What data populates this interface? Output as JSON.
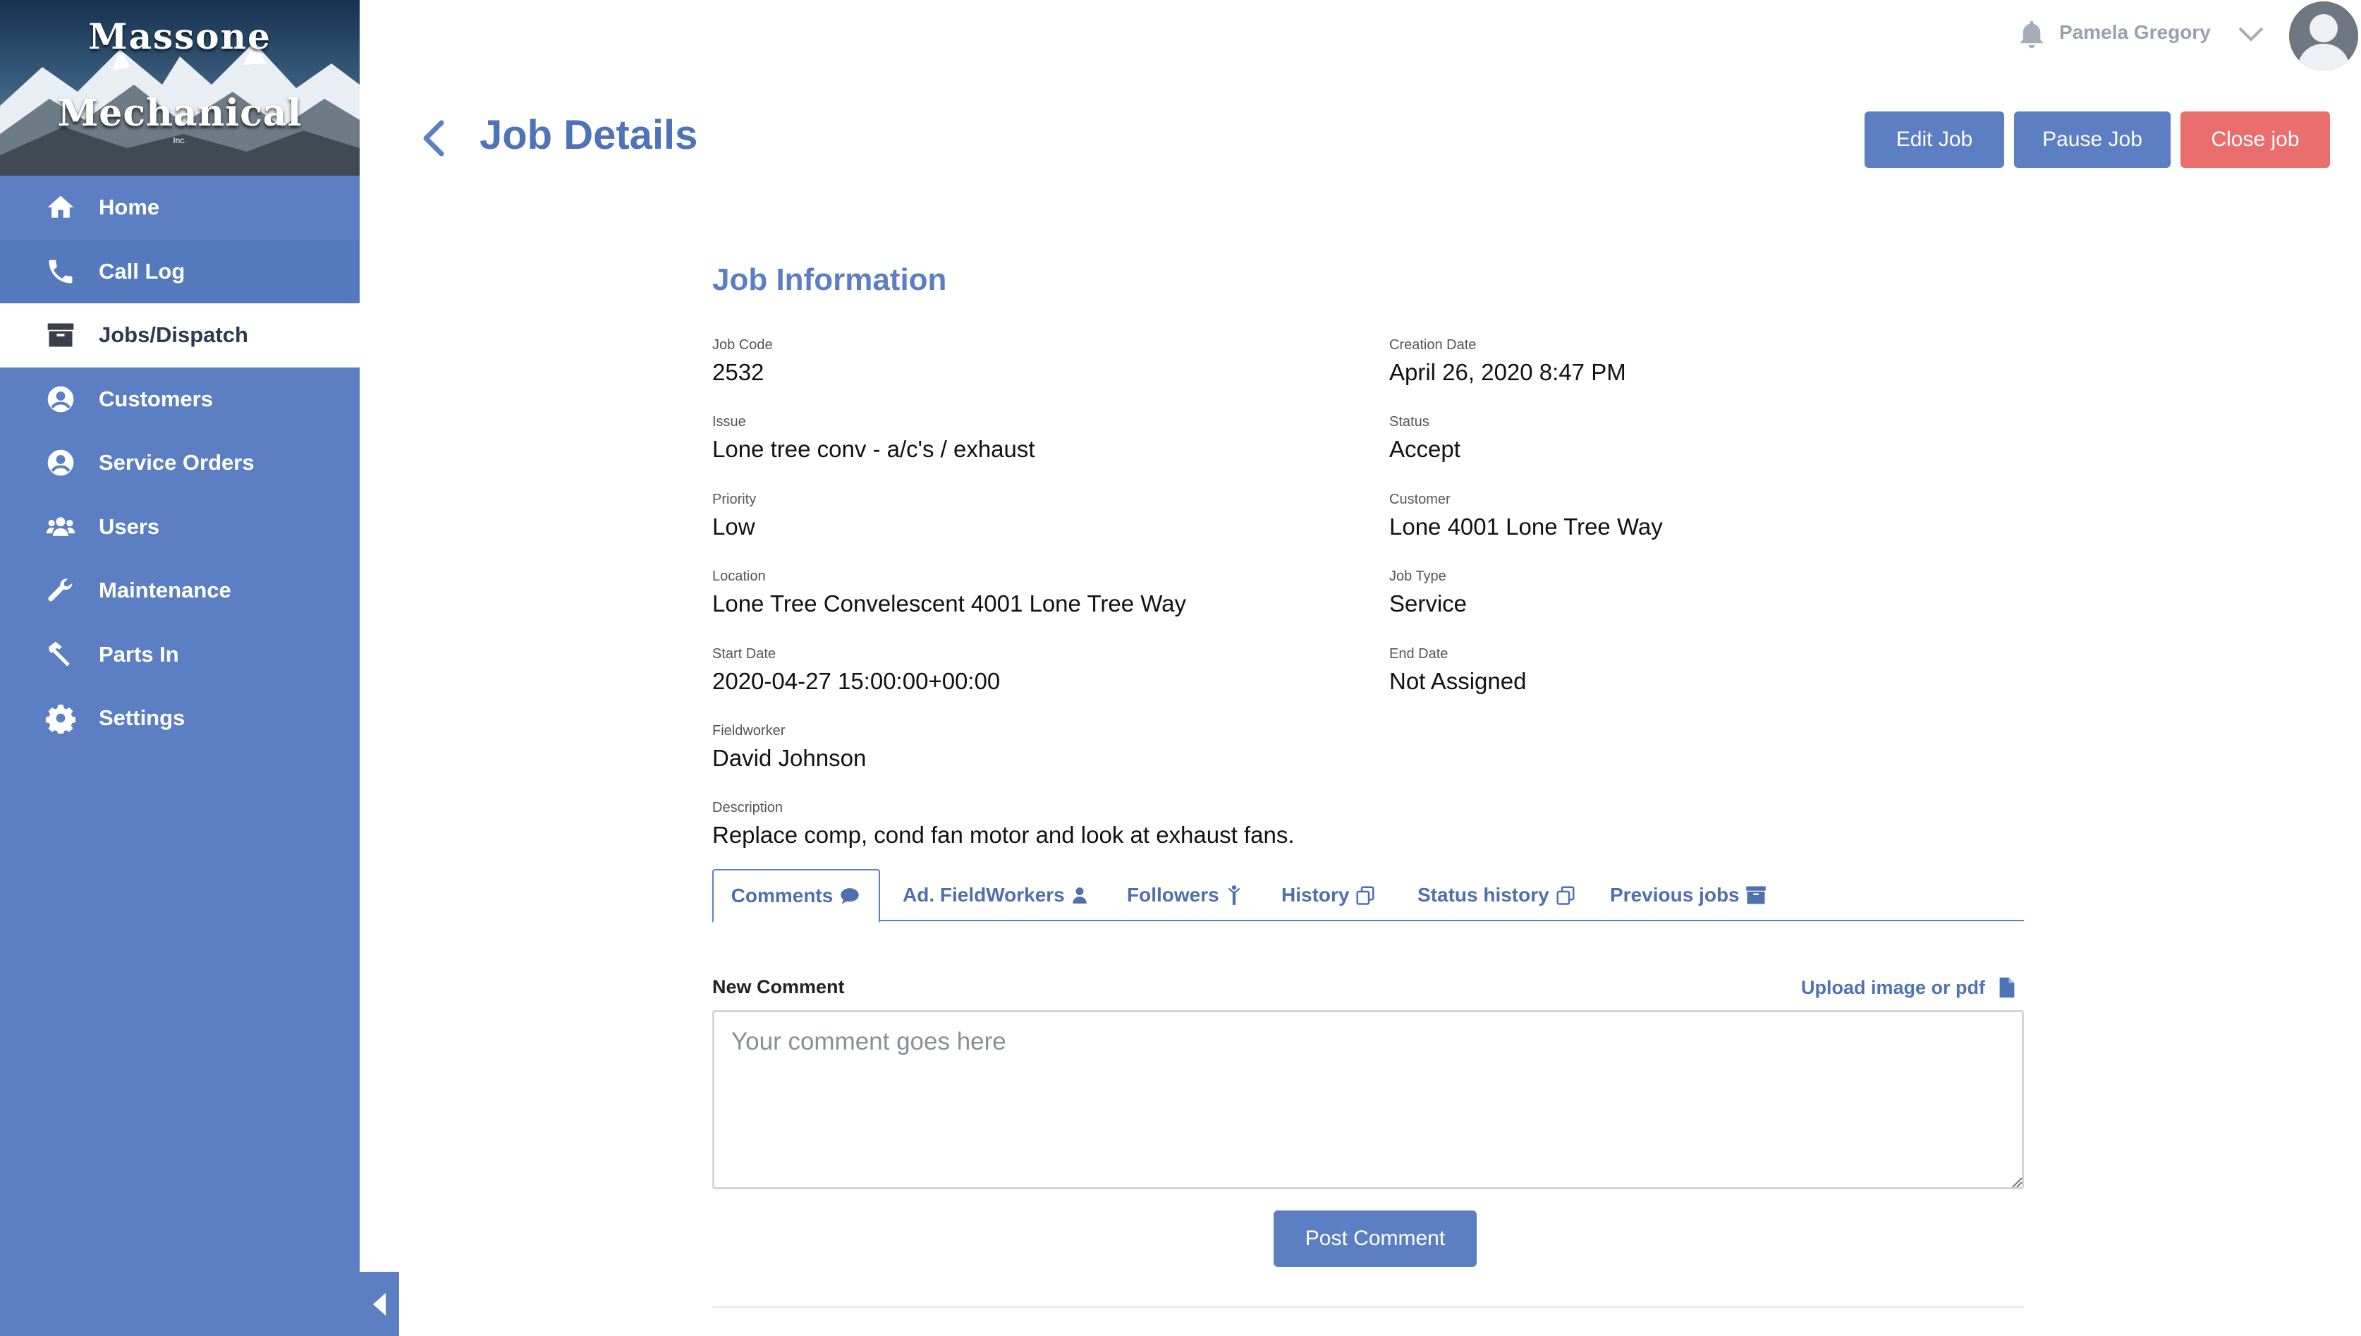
{
  "logo": {
    "line1": "Massone",
    "line2": "Mechanical",
    "line3": "Inc."
  },
  "nav": {
    "items": [
      {
        "label": "Home",
        "icon": "home-icon"
      },
      {
        "label": "Call Log",
        "icon": "phone-icon"
      },
      {
        "label": "Jobs/Dispatch",
        "icon": "archive-icon",
        "active": true
      },
      {
        "label": "Customers",
        "icon": "user-circle-icon"
      },
      {
        "label": "Service Orders",
        "icon": "user-circle-icon"
      },
      {
        "label": "Users",
        "icon": "users-icon"
      },
      {
        "label": "Maintenance",
        "icon": "wrench-icon"
      },
      {
        "label": "Parts In",
        "icon": "hammer-icon"
      },
      {
        "label": "Settings",
        "icon": "gear-icon"
      }
    ]
  },
  "user": {
    "name": "Pamela Gregory"
  },
  "header": {
    "title": "Job Details"
  },
  "actions": {
    "edit": "Edit Job",
    "pause": "Pause Job",
    "close": "Close job"
  },
  "job": {
    "section_title": "Job Information",
    "job_code": {
      "label": "Job Code",
      "value": "2532"
    },
    "creation_date": {
      "label": "Creation Date",
      "value": "April 26, 2020 8:47 PM"
    },
    "issue": {
      "label": "Issue",
      "value": "Lone tree conv - a/c's / exhaust"
    },
    "status": {
      "label": "Status",
      "value": "Accept"
    },
    "priority": {
      "label": "Priority",
      "value": "Low"
    },
    "customer": {
      "label": "Customer",
      "value": "Lone 4001 Lone Tree Way"
    },
    "location": {
      "label": "Location",
      "value": "Lone Tree Convelescent 4001 Lone Tree Way"
    },
    "job_type": {
      "label": "Job Type",
      "value": "Service"
    },
    "start_date": {
      "label": "Start Date",
      "value": "2020-04-27 15:00:00+00:00"
    },
    "end_date": {
      "label": "End Date",
      "value": "Not Assigned"
    },
    "fieldworker": {
      "label": "Fieldworker",
      "value": "David Johnson"
    },
    "description": {
      "label": "Description",
      "value": "Replace comp, cond fan motor and look at exhaust fans."
    }
  },
  "tabs": {
    "comments": "Comments",
    "fieldworkers": "Ad. FieldWorkers",
    "followers": "Followers",
    "history": "History",
    "status_history": "Status history",
    "previous_jobs": "Previous jobs"
  },
  "comment": {
    "label": "New Comment",
    "upload": "Upload image or pdf",
    "placeholder": "Your comment goes here",
    "value": "",
    "post": "Post Comment"
  },
  "colors": {
    "primary": "#5b7fc2",
    "danger": "#ea6e6e",
    "sidebar": "#5b7fc2"
  }
}
